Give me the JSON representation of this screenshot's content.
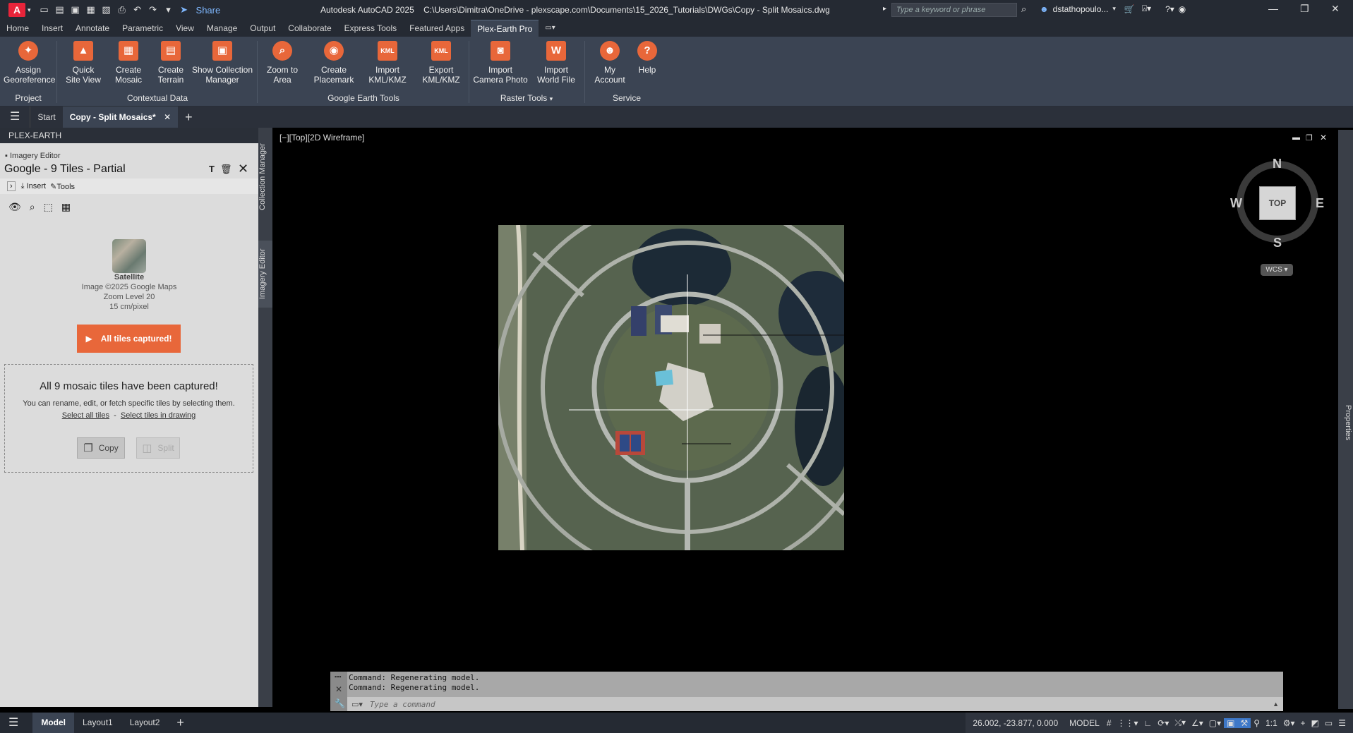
{
  "app": {
    "title": "Autodesk AutoCAD 2025",
    "path": "C:\\Users\\Dimitra\\OneDrive - plexscape.com\\Documents\\15_2026_Tutorials\\DWGs\\Copy - Split Mosaics.dwg",
    "share_label": "Share",
    "search_placeholder": "Type a keyword or phrase",
    "user": "dstathopoulo..."
  },
  "menu": {
    "tabs": [
      "Home",
      "Insert",
      "Annotate",
      "Parametric",
      "View",
      "Manage",
      "Output",
      "Collaborate",
      "Express Tools",
      "Featured Apps",
      "Plex-Earth Pro"
    ]
  },
  "ribbon": {
    "buttons": [
      {
        "l1": "Assign",
        "l2": "Georeference",
        "icon": "georeference-icon"
      },
      {
        "l1": "Quick",
        "l2": "Site View",
        "icon": "site-view-icon"
      },
      {
        "l1": "Create",
        "l2": "Mosaic",
        "icon": "mosaic-icon"
      },
      {
        "l1": "Create",
        "l2": "Terrain",
        "icon": "terrain-icon"
      },
      {
        "l1": "Show Collection",
        "l2": "Manager",
        "icon": "collection-icon"
      },
      {
        "l1": "Zoom to",
        "l2": "Area",
        "icon": "zoom-area-icon"
      },
      {
        "l1": "Create",
        "l2": "Placemark",
        "icon": "placemark-icon"
      },
      {
        "l1": "Import",
        "l2": "KML/KMZ",
        "icon": "kml-import-icon"
      },
      {
        "l1": "Export",
        "l2": "KML/KMZ",
        "icon": "kml-export-icon"
      },
      {
        "l1": "Import",
        "l2": "Camera Photo",
        "icon": "camera-icon"
      },
      {
        "l1": "Import",
        "l2": "World File",
        "icon": "world-file-icon"
      },
      {
        "l1": "My",
        "l2": "Account",
        "icon": "account-icon"
      },
      {
        "l1": "Help",
        "l2": "",
        "icon": "help-icon"
      }
    ],
    "groups": [
      "Project",
      "Contextual Data",
      "Google Earth Tools",
      "Raster Tools",
      "Service"
    ]
  },
  "file_tabs": {
    "start": "Start",
    "active": "Copy - Split Mosaics*"
  },
  "panel": {
    "header": "PLEX-EARTH",
    "section": "Imagery Editor",
    "title": "Google - 9 Tiles - Partial",
    "toolbar_insert": "Insert",
    "toolbar_tools": "Tools",
    "source_name": "Satellite",
    "copyright": "Image ©2025 Google Maps",
    "zoom": "Zoom Level 20",
    "resolution": "15 cm/pixel",
    "captured_button": "All tiles captured!",
    "msg_title": "All 9 mosaic tiles have been captured!",
    "msg_body": "You can rename, edit, or fetch specific tiles by selecting them.",
    "link_all": "Select all tiles",
    "link_sep": "-",
    "link_drawing": "Select tiles in drawing",
    "copy_label": "Copy",
    "split_label": "Split",
    "vtab_collection": "Collection Manager",
    "vtab_imagery": "Imagery Editor"
  },
  "viewport": {
    "label": "[−][Top][2D Wireframe]",
    "compass": {
      "n": "N",
      "s": "S",
      "e": "E",
      "w": "W",
      "top": "TOP",
      "wcs": "WCS"
    },
    "properties_label": "Properties"
  },
  "command": {
    "lines": [
      "Command: Regenerating model.",
      "Command: Regenerating model."
    ],
    "placeholder": "Type a command"
  },
  "statusbar": {
    "tabs": [
      "Model",
      "Layout1",
      "Layout2"
    ],
    "coords": "26.002, -23.877, 0.000",
    "mode": "MODEL",
    "scale": "1:1"
  },
  "colors": {
    "accent": "#e8673a",
    "ribbon": "#3b4453",
    "dark": "#252a33"
  }
}
